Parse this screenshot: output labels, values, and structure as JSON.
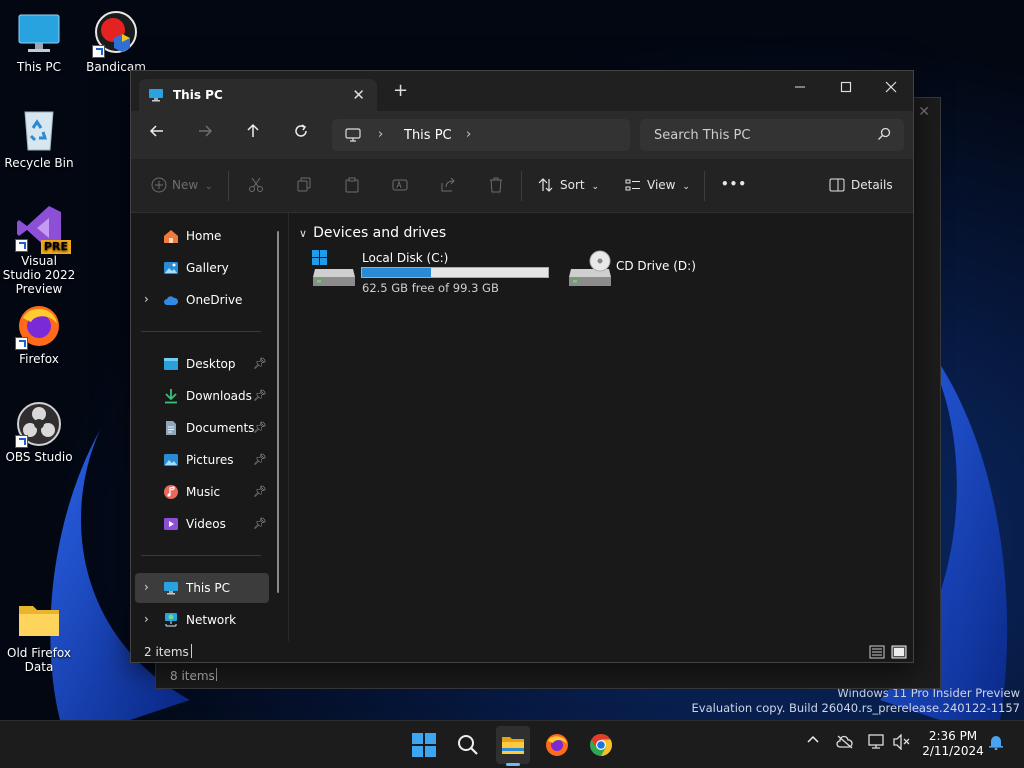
{
  "desktop": {
    "icons": [
      {
        "label": "This PC",
        "icon": "monitor-icon"
      },
      {
        "label": "Bandicam",
        "icon": "bandicam-icon"
      },
      {
        "label": "Recycle Bin",
        "icon": "recycle-bin-icon"
      },
      {
        "label": "Visual Studio 2022 Preview",
        "icon": "visual-studio-icon",
        "badge": "PRE"
      },
      {
        "label": "Firefox",
        "icon": "firefox-icon"
      },
      {
        "label": "OBS Studio",
        "icon": "obs-icon"
      },
      {
        "label": "Old Firefox Data",
        "icon": "folder-icon"
      }
    ],
    "watermark_line1": "Windows 11 Pro Insider Preview",
    "watermark_line2": "Evaluation copy. Build 26040.rs_prerelease.240122-1157"
  },
  "background_window": {
    "status": "8 items"
  },
  "window": {
    "tab_title": "This PC",
    "address": {
      "location": "This PC"
    },
    "search": {
      "placeholder": "Search This PC",
      "value": ""
    },
    "commands": {
      "new_label": "New",
      "sort_label": "Sort",
      "view_label": "View",
      "more_label": "•••",
      "details_label": "Details"
    },
    "sidebar": {
      "items": [
        {
          "label": "Home"
        },
        {
          "label": "Gallery"
        },
        {
          "label": "OneDrive"
        },
        {
          "label": "Desktop"
        },
        {
          "label": "Downloads"
        },
        {
          "label": "Documents"
        },
        {
          "label": "Pictures"
        },
        {
          "label": "Music"
        },
        {
          "label": "Videos"
        },
        {
          "label": "This PC"
        },
        {
          "label": "Network"
        }
      ]
    },
    "content": {
      "group_header": "Devices and drives",
      "drives": [
        {
          "name": "Local Disk (C:)",
          "free_text": "62.5 GB free of 99.3 GB",
          "used_fraction": 0.37
        },
        {
          "name": "CD Drive (D:)"
        }
      ]
    },
    "status": {
      "item_count": "2 items"
    }
  },
  "taskbar": {
    "clock_time": "2:36 PM",
    "clock_date": "2/11/2024"
  },
  "colors": {
    "accent": "#2a8ad4",
    "window_bg": "#191919",
    "taskbar_bg": "#1c1c1c"
  }
}
